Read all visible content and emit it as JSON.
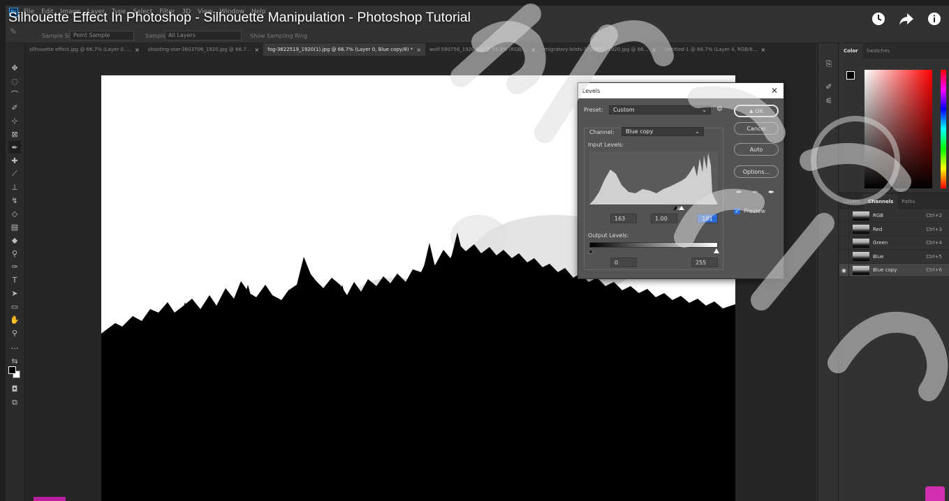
{
  "video": {
    "title": "Silhouette Effect In Photoshop - Silhouette Manipulation - Photoshop Tutorial"
  },
  "menu": {
    "logo": "Ps",
    "items": [
      "File",
      "Edit",
      "Image",
      "Layer",
      "Type",
      "Select",
      "Filter",
      "3D",
      "View",
      "Window",
      "Help"
    ]
  },
  "options": {
    "sample_size_label": "Sample Size:",
    "sample_size_value": "Point Sample",
    "sample_label": "Sample:",
    "sample_value": "All Layers",
    "show_ring": "Show Sampling Ring"
  },
  "tabs": [
    {
      "label": "silhouette effect.jpg @ 66.7% (Layer 0, ...",
      "active": false
    },
    {
      "label": "shooting-star-3603706_1920.jpg @ 66.7...",
      "active": false
    },
    {
      "label": "fog-3622519_1920(1).jpg @ 66.7% (Layer 0, Blue copy/8) *",
      "active": true
    },
    {
      "label": "wolf-590756_1920.jpg @ 33.3% (RGB/...",
      "active": false
    },
    {
      "label": "migratory-birds-3700977_1920.jpg @ 66...",
      "active": false
    },
    {
      "label": "Untitled-1 @ 66.7% (Layer 4, RGB/8...",
      "active": false
    }
  ],
  "color_panel": {
    "tabs": [
      "Color",
      "Swatches"
    ]
  },
  "channels_panel": {
    "tabs": [
      "Layers",
      "Channels",
      "Paths"
    ],
    "rows": [
      {
        "name": "RGB",
        "shortcut": "Ctrl+2",
        "visible": false,
        "selected": false
      },
      {
        "name": "Red",
        "shortcut": "Ctrl+3",
        "visible": false,
        "selected": false
      },
      {
        "name": "Green",
        "shortcut": "Ctrl+4",
        "visible": false,
        "selected": false
      },
      {
        "name": "Blue",
        "shortcut": "Ctrl+5",
        "visible": false,
        "selected": false
      },
      {
        "name": "Blue copy",
        "shortcut": "Ctrl+6",
        "visible": true,
        "selected": true
      }
    ]
  },
  "levels": {
    "title": "Levels",
    "preset_label": "Preset:",
    "preset_value": "Custom",
    "channel_label": "Channel:",
    "channel_value": "Blue copy",
    "input_levels_label": "Input Levels:",
    "input_black": "163",
    "input_gamma": "1.00",
    "input_white": "181",
    "output_levels_label": "Output Levels:",
    "output_black": "0",
    "output_white": "255",
    "ok": "OK",
    "cancel": "Cancel",
    "auto": "Auto",
    "options": "Options...",
    "preview_label": "Preview",
    "preview_checked": true
  },
  "colors": {
    "accent": "#2a6bd8",
    "bottom_logo": "#b61fa0"
  }
}
